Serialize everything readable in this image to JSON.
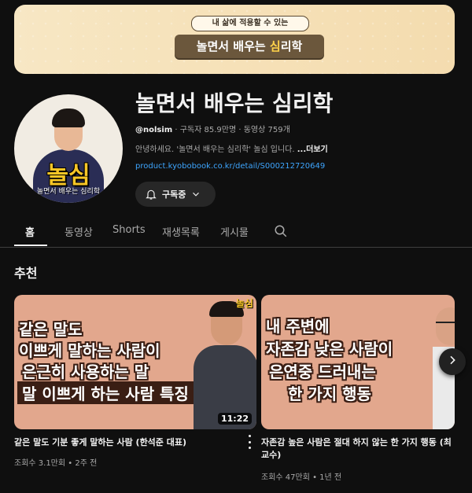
{
  "banner": {
    "subtitle": "내 삶에 적용할 수 있는",
    "title_part1": "놀면서 배우는 ",
    "title_highlight": "심",
    "title_part2": "리학"
  },
  "avatar": {
    "logo_text": "놀심",
    "logo_sub": "놀면서 배우는 심리학"
  },
  "channel": {
    "name": "놀면서 배우는 심리학",
    "handle": "@nolsim",
    "meta": " · 구독자 85.9만명 · 동영상 759개",
    "description": "안녕하세요. '놀면서 배우는 심리학' 놀심 입니다. ",
    "more_label": "...더보기",
    "link": "product.kyobobook.co.kr/detail/S000212720649"
  },
  "subscribe_button": {
    "label": "구독중"
  },
  "tabs": [
    {
      "label": "홈"
    },
    {
      "label": "동영상"
    },
    {
      "label": "Shorts"
    },
    {
      "label": "재생목록"
    },
    {
      "label": "게시물"
    }
  ],
  "section": {
    "title": "추천"
  },
  "videos": [
    {
      "thumb_lines": [
        "같은 말도",
        "이쁘게 말하는 사람이",
        "은근히 사용하는 말",
        "말 이쁘게 하는 사람 특징"
      ],
      "badge": "놀심",
      "duration": "11:22",
      "title": "같은 말도 기분 좋게 말하는 사람 (한석준 대표)",
      "meta": "조회수 3.1만회 • 2주 전"
    },
    {
      "thumb_lines": [
        "내 주변에",
        "자존감 낮은 사람이",
        "은연중 드러내는",
        "한 가지 행동"
      ],
      "title": "자존감 높은 사람은 절대 하지 않는 한 가지 행동 (최 교수)",
      "meta": "조회수 47만회 • 1년 전"
    }
  ],
  "colors": {
    "background": "#0f0f0f",
    "link": "#3ea6ff",
    "thumb_bg": "#e2a78d",
    "banner_bg": "#f6e1b8"
  }
}
